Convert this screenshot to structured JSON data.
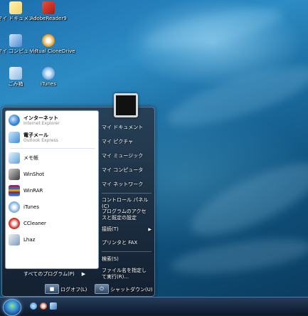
{
  "desktop_icons": [
    {
      "label": "マイ ドキュメント",
      "icon": "documents-icon",
      "color": "#f5d36a"
    },
    {
      "label": "AdobeReader9",
      "icon": "adobe-reader-icon",
      "color": "#c8251b"
    },
    {
      "label": "マイ コンピュータ",
      "icon": "computer-icon",
      "color": "#6fb2e8"
    },
    {
      "label": "Virtual CloneDrive",
      "icon": "clone-drive-icon",
      "color": "#e8a63a"
    },
    {
      "label": "ごみ箱",
      "icon": "recycle-bin-icon",
      "color": "#9fcbe6"
    },
    {
      "label": "iTunes",
      "icon": "itunes-icon",
      "color": "#8fb6e0"
    }
  ],
  "start_menu": {
    "pinned": [
      {
        "name": "インターネット",
        "sub": "Internet Explorer",
        "icon": "internet-explorer-icon",
        "color": "#2a7fd4"
      },
      {
        "name": "電子メール",
        "sub": "Outlook Express",
        "icon": "outlook-express-icon",
        "color": "#3b8ad8"
      }
    ],
    "recent": [
      {
        "name": "メモ帳",
        "icon": "notepad-icon",
        "color": "#5fa0d8"
      },
      {
        "name": "WinShot",
        "icon": "winshot-icon",
        "color": "#5a5a5a"
      },
      {
        "name": "WinRAR",
        "icon": "winrar-icon",
        "color": "#8b2a6e"
      },
      {
        "name": "iTunes",
        "icon": "itunes-icon",
        "color": "#6da5dc"
      },
      {
        "name": "CCleaner",
        "icon": "ccleaner-icon",
        "color": "#d0322a"
      },
      {
        "name": "Lhaz",
        "icon": "lhaz-icon",
        "color": "#7a9ac0"
      }
    ],
    "all_programs": "すべてのプログラム(P)",
    "right_items": [
      {
        "label": "マイ ドキュメント"
      },
      {
        "label": "マイ ピクチャ"
      },
      {
        "label": "マイ ミュージック"
      },
      {
        "label": "マイ コンピュータ"
      },
      {
        "label": "マイ ネットワーク"
      },
      {
        "label": "コントロール パネル(C)"
      },
      {
        "label": "プログラムのアクセスと既定の設定"
      },
      {
        "label": "接続(T)"
      },
      {
        "label": "プリンタと FAX"
      },
      {
        "label": "検索(S)"
      },
      {
        "label": "ファイル名を指定して実行(R)..."
      }
    ],
    "logoff": "ログオフ(L)",
    "shutdown": "シャットダウン(U)"
  }
}
